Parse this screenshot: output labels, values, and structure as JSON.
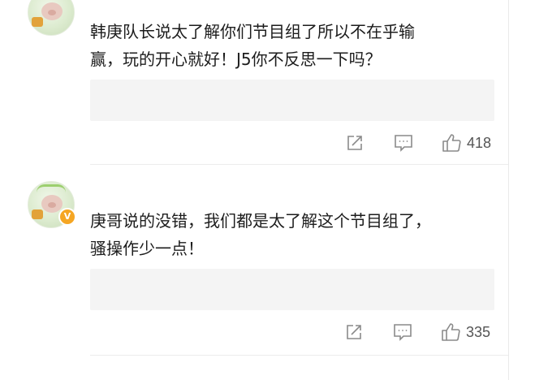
{
  "comments": [
    {
      "text_line1": "韩庚队长说太了解你们节目组了所以不在乎输",
      "text_line2": "赢，玩的开心就好！J5你不反思一下吗？",
      "verified": false,
      "like_count": "418",
      "badge_label": ""
    },
    {
      "text_line1": "庚哥说的没错，我们都是太了解这个节目组了，",
      "text_line2": "骚操作少一点！",
      "verified": true,
      "like_count": "335",
      "badge_label": "V"
    }
  ],
  "colors": {
    "icon_gray": "#8a8a8a",
    "verified_badge": "#f5a623",
    "placeholder_bg": "#f4f4f4"
  },
  "icons": {
    "share": "share-icon",
    "comment": "comment-icon",
    "like": "thumbs-up-icon"
  }
}
